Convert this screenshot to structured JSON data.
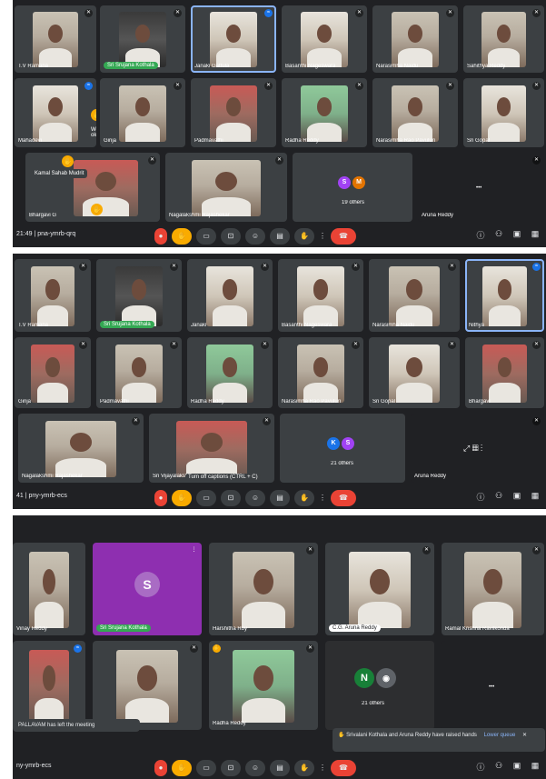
{
  "panel1": {
    "tiles": [
      {
        "name": "T.V Ramana",
        "style": ""
      },
      {
        "name": "Sri Srujana Kothala",
        "style": "hl"
      },
      {
        "name": "Janaki Gattula",
        "style": ""
      },
      {
        "name": "Basanthi Nageswara",
        "style": ""
      },
      {
        "name": "Narasimha Naidu",
        "style": ""
      },
      {
        "name": "Sahithya Reddy",
        "style": ""
      },
      {
        "name": "Mahadevi",
        "style": ""
      },
      {
        "name": "Girija",
        "style": ""
      },
      {
        "name": "Padmavathi",
        "style": ""
      },
      {
        "name": "Radha Reddy",
        "style": ""
      },
      {
        "name": "Narasimha Rao Pavuluri",
        "style": ""
      },
      {
        "name": "Sri Gopal",
        "style": ""
      },
      {
        "name": "Bhargavi G",
        "style": ""
      },
      {
        "name": "Nagalakshmi Rajashekar",
        "style": ""
      },
      {
        "name": "Aruna Reddy",
        "style": ""
      }
    ],
    "hand_label": "Kamal Sahab Mudrit",
    "bubble": "Well, ok",
    "others": "19 others",
    "avatars": [
      "S",
      "M"
    ],
    "meet_code": "21:49 | pna-ymrb-qrq"
  },
  "panel2": {
    "tiles": [
      {
        "name": "T.V Ramana",
        "style": ""
      },
      {
        "name": "Sri Srujana Kothala",
        "style": "hl"
      },
      {
        "name": "Janaki",
        "style": ""
      },
      {
        "name": "Basanthi Nageswara",
        "style": ""
      },
      {
        "name": "Narasimha Naidu",
        "style": ""
      },
      {
        "name": "Nithya",
        "style": ""
      },
      {
        "name": "Girija",
        "style": ""
      },
      {
        "name": "Padmavathi",
        "style": ""
      },
      {
        "name": "Radha Reddy",
        "style": ""
      },
      {
        "name": "Narasimha Rao Pavuluri",
        "style": ""
      },
      {
        "name": "Sri Gopal",
        "style": ""
      },
      {
        "name": "Bhargavi",
        "style": ""
      },
      {
        "name": "Nagalakshmi Rajashekar",
        "style": ""
      },
      {
        "name": "Sri Vijayalakshmi",
        "style": ""
      },
      {
        "name": "Aruna Reddy",
        "style": ""
      }
    ],
    "others": "21 others",
    "avatars": [
      "K",
      "S"
    ],
    "caption": "Turn off captions (CTRL + C)",
    "meet_code": "41 | pny-ymrb-ecs"
  },
  "panel3": {
    "tiles": [
      {
        "name": "Vinay Reddy",
        "style": ""
      },
      {
        "name": "Sri Srujana Kothala",
        "style": "hl",
        "avatar": "S"
      },
      {
        "name": "Harshitha Roy",
        "style": ""
      },
      {
        "name": "C.G. Aruna Reddy",
        "style": "wh"
      },
      {
        "name": "Ramal Krishna Ravilkonda",
        "style": ""
      },
      {
        "name": "",
        "style": ""
      },
      {
        "name": "",
        "style": ""
      },
      {
        "name": "Radha Reddy",
        "style": ""
      }
    ],
    "left_toast": "PALLAVAM has left the meeting",
    "others": "21 others",
    "avatar": "N",
    "raise_toast": "Srivalani Kothala and Aruna Reddy have raised hands",
    "raise_action": "Lower queue",
    "meet_code": "ny-ymrb-ecs"
  },
  "controls": [
    "mic",
    "cam",
    "cc",
    "emoji",
    "present",
    "hand",
    "more"
  ],
  "colors": {
    "bg": "#202124",
    "tile": "#3c4043",
    "accent": "#8ab4f8",
    "hangup": "#ea4335",
    "hand": "#f9ab00",
    "hl": "#34a853",
    "purple": "#8e2fb0"
  }
}
